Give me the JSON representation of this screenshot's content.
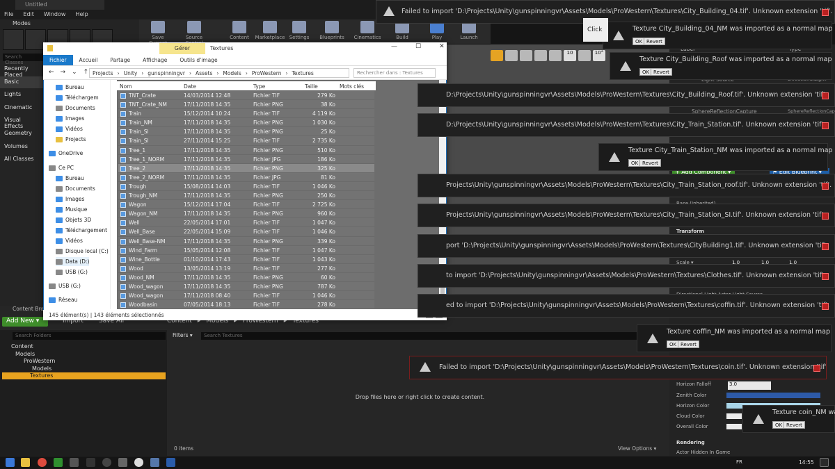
{
  "ue": {
    "tab_title": "Untitled",
    "menu": [
      "File",
      "Edit",
      "Window",
      "Help"
    ],
    "modes_title": "Modes",
    "search_classes": "Search Classes",
    "categories": [
      "Recently Placed",
      "Basic",
      "Lights",
      "Cinematic",
      "Visual Effects",
      "Geometry",
      "Volumes",
      "All Classes"
    ],
    "toolbar": [
      "Save Current",
      "Source Control",
      "Content",
      "Marketplace",
      "Settings",
      "Blueprints",
      "Cinematics",
      "Build",
      "Play",
      "Launch"
    ],
    "viewport_numbers": [
      "10",
      "10°"
    ],
    "outliner": {
      "col_label": "Label",
      "col_type": "Type",
      "rows": [
        {
          "label": "Light Source",
          "type": "DirectionalLight"
        },
        {
          "label": "SphereReflectionCapture",
          "type": "SphereReflectionCapture"
        }
      ]
    },
    "details": {
      "add_component": "+ Add Component ▾",
      "edit_blueprint": "⚑ Edit Blueprint ▾",
      "base": "Base (Inherited)",
      "transform": "Transform",
      "scale_label": "Scale ▾",
      "scale": [
        "1.0",
        "1.0",
        "1.0"
      ],
      "horizon_falloff_label": "Horizon Falloff",
      "horizon_falloff": "3.0",
      "zenith": "Zenith Color",
      "horizon": "Horizon Color",
      "cloud": "Cloud Color",
      "overall": "Overall Color",
      "rendering": "Rendering",
      "hidden": "Actor Hidden In Game",
      "light_source": "Directional Light Actor Light Source"
    },
    "content_browser": {
      "tab": "Content Browser",
      "add_new": "Add New ▾",
      "import": "Import",
      "save_all": "Save All",
      "breadcrumb": [
        "Content",
        "Models",
        "ProWestern",
        "Textures"
      ],
      "search_folders": "Search Folders",
      "filters": "Filters ▾",
      "search_textures": "Search Textures",
      "tree": [
        "Content",
        "Models",
        "ProWestern",
        "Models",
        "Textures"
      ],
      "drop_text": "Drop files here or right click to create content.",
      "items": "0 items",
      "view_options": "View Options ▾"
    }
  },
  "explorer": {
    "gerer": "Gérer",
    "title": "Textures",
    "ribbon": [
      "Fichier",
      "Accueil",
      "Partage",
      "Affichage",
      "Outils d'image"
    ],
    "address": [
      "Projects",
      "Unity",
      "gunspinningvr",
      "Assets",
      "Models",
      "ProWestern",
      "Textures"
    ],
    "search": "Rechercher dans : Textures",
    "nav": [
      {
        "label": "Bureau",
        "ic": "b"
      },
      {
        "label": "Téléchargem",
        "ic": "b"
      },
      {
        "label": "Documents",
        "ic": "g"
      },
      {
        "label": "Images",
        "ic": "b"
      },
      {
        "label": "Vidéos",
        "ic": "b"
      },
      {
        "label": "Projects",
        "ic": "y"
      },
      {
        "label": "OneDrive",
        "ic": "b"
      },
      {
        "label": "Ce PC",
        "ic": "g"
      },
      {
        "label": "Bureau",
        "ic": "b"
      },
      {
        "label": "Documents",
        "ic": "g"
      },
      {
        "label": "Images",
        "ic": "b"
      },
      {
        "label": "Musique",
        "ic": "b"
      },
      {
        "label": "Objets 3D",
        "ic": "b"
      },
      {
        "label": "Téléchargement",
        "ic": "b"
      },
      {
        "label": "Vidéos",
        "ic": "b"
      },
      {
        "label": "Disque local (C:)",
        "ic": "g"
      },
      {
        "label": "Data (D:)",
        "ic": "g"
      },
      {
        "label": "USB (G:)",
        "ic": "g"
      },
      {
        "label": "USB (G:)",
        "ic": "g"
      },
      {
        "label": "Réseau",
        "ic": "b"
      }
    ],
    "columns": [
      "Nom",
      "Date",
      "Type",
      "Taille",
      "Mots clés"
    ],
    "files": [
      [
        "TNT_Crate",
        "14/03/2014 12:48",
        "Fichier TIF",
        "279 Ko"
      ],
      [
        "TNT_Crate_NM",
        "17/11/2018 14:35",
        "Fichier PNG",
        "38 Ko"
      ],
      [
        "Train",
        "15/12/2014 10:24",
        "Fichier TIF",
        "4 119 Ko"
      ],
      [
        "Train_NM",
        "17/11/2018 14:35",
        "Fichier PNG",
        "1 030 Ko"
      ],
      [
        "Train_SI",
        "17/11/2018 14:35",
        "Fichier PNG",
        "25 Ko"
      ],
      [
        "Train_SI",
        "27/11/2014 15:25",
        "Fichier TIF",
        "2 735 Ko"
      ],
      [
        "Tree_1",
        "17/11/2018 14:35",
        "Fichier PNG",
        "510 Ko"
      ],
      [
        "Tree_1_NORM",
        "17/11/2018 14:35",
        "Fichier JPG",
        "186 Ko"
      ],
      [
        "Tree_2",
        "17/11/2018 14:35",
        "Fichier PNG",
        "325 Ko"
      ],
      [
        "Tree_2_NORM",
        "17/11/2018 14:35",
        "Fichier JPG",
        "81 Ko"
      ],
      [
        "Trough",
        "15/08/2014 14:03",
        "Fichier TIF",
        "1 046 Ko"
      ],
      [
        "Trough_NM",
        "17/11/2018 14:35",
        "Fichier PNG",
        "250 Ko"
      ],
      [
        "Wagon",
        "15/12/2014 17:04",
        "Fichier TIF",
        "2 725 Ko"
      ],
      [
        "Wagon_NM",
        "17/11/2018 14:35",
        "Fichier PNG",
        "960 Ko"
      ],
      [
        "Well",
        "22/05/2014 17:01",
        "Fichier TIF",
        "1 047 Ko"
      ],
      [
        "Well_Base",
        "22/05/2014 15:09",
        "Fichier TIF",
        "1 046 Ko"
      ],
      [
        "Well_Base-NM",
        "17/11/2018 14:35",
        "Fichier PNG",
        "339 Ko"
      ],
      [
        "Wind_Farm",
        "15/05/2014 12:08",
        "Fichier TIF",
        "1 047 Ko"
      ],
      [
        "Wine_Bottle",
        "01/10/2014 17:43",
        "Fichier TIF",
        "1 043 Ko"
      ],
      [
        "Wood",
        "13/05/2014 13:19",
        "Fichier TIF",
        "277 Ko"
      ],
      [
        "Wood_NM",
        "17/11/2018 14:35",
        "Fichier PNG",
        "60 Ko"
      ],
      [
        "Wood_wagon",
        "17/11/2018 14:35",
        "Fichier PNG",
        "787 Ko"
      ],
      [
        "Wood_wagon",
        "17/11/2018 08:40",
        "Fichier TIF",
        "1 046 Ko"
      ],
      [
        "Woodbasin",
        "07/05/2014 18:13",
        "Fichier TIF",
        "278 Ko"
      ]
    ],
    "status": "145 élément(s)  |  143 éléments sélectionnés"
  },
  "toasts_error": [
    {
      "text": "Failed to import 'D:\\Projects\\Unity\\gunspinningvr\\Assets\\Models\\ProWestern\\Textures\\City_Building_04.tif'. Unknown extension 'tif'."
    },
    {
      "text": "D:\\Projects\\Unity\\gunspinningvr\\Assets\\Models\\ProWestern\\Textures\\City_Building_Roof.tif'. Unknown extension 'tif'."
    },
    {
      "text": "D:\\Projects\\Unity\\gunspinningvr\\Assets\\Models\\ProWestern\\Textures\\City_Train_Station.tif'. Unknown extension 'tif'."
    },
    {
      "text": "Projects\\Unity\\gunspinningvr\\Assets\\Models\\ProWestern\\Textures\\City_Train_Station_roof.tif'. Unknown extension 'tif'."
    },
    {
      "text": "Projects\\Unity\\gunspinningvr\\Assets\\Models\\ProWestern\\Textures\\City_Train_Station_SI.tif'. Unknown extension 'tif'."
    },
    {
      "text": "port 'D:\\Projects\\Unity\\gunspinningvr\\Assets\\Models\\ProWestern\\Textures\\CityBuilding1.tif'. Unknown extension 'tif'."
    },
    {
      "text": "to import 'D:\\Projects\\Unity\\gunspinningvr\\Assets\\Models\\ProWestern\\Textures\\Clothes.tif'. Unknown extension 'tif'."
    },
    {
      "text": "ed to import 'D:\\Projects\\Unity\\gunspinningvr\\Assets\\Models\\ProWestern\\Textures\\coffin.tif'. Unknown extension 'tif'."
    },
    {
      "text": "Failed to import 'D:\\Projects\\Unity\\gunspinningvr\\Assets\\Models\\ProWestern\\Textures\\coin.tif'. Unknown extension 'tif'."
    }
  ],
  "toasts_normal": [
    {
      "text": "Texture City_Building_04_NM was imported as a normal map",
      "ok": "OK",
      "revert": "Revert"
    },
    {
      "text": "Texture City_Building_Roof was imported as a normal map",
      "ok": "OK",
      "revert": "Revert"
    },
    {
      "text": "Texture City_Train_Station_NM was imported as a normal map",
      "ok": "OK",
      "revert": "Revert"
    },
    {
      "text": "Texture coffin_NM was imported as a normal map",
      "ok": "OK",
      "revert": "Revert"
    },
    {
      "text": "Texture coin_NM was",
      "ok": "OK",
      "revert": "Revert"
    }
  ],
  "click_text": "Click",
  "taskbar": {
    "lang": "FR",
    "time": "14:55"
  }
}
